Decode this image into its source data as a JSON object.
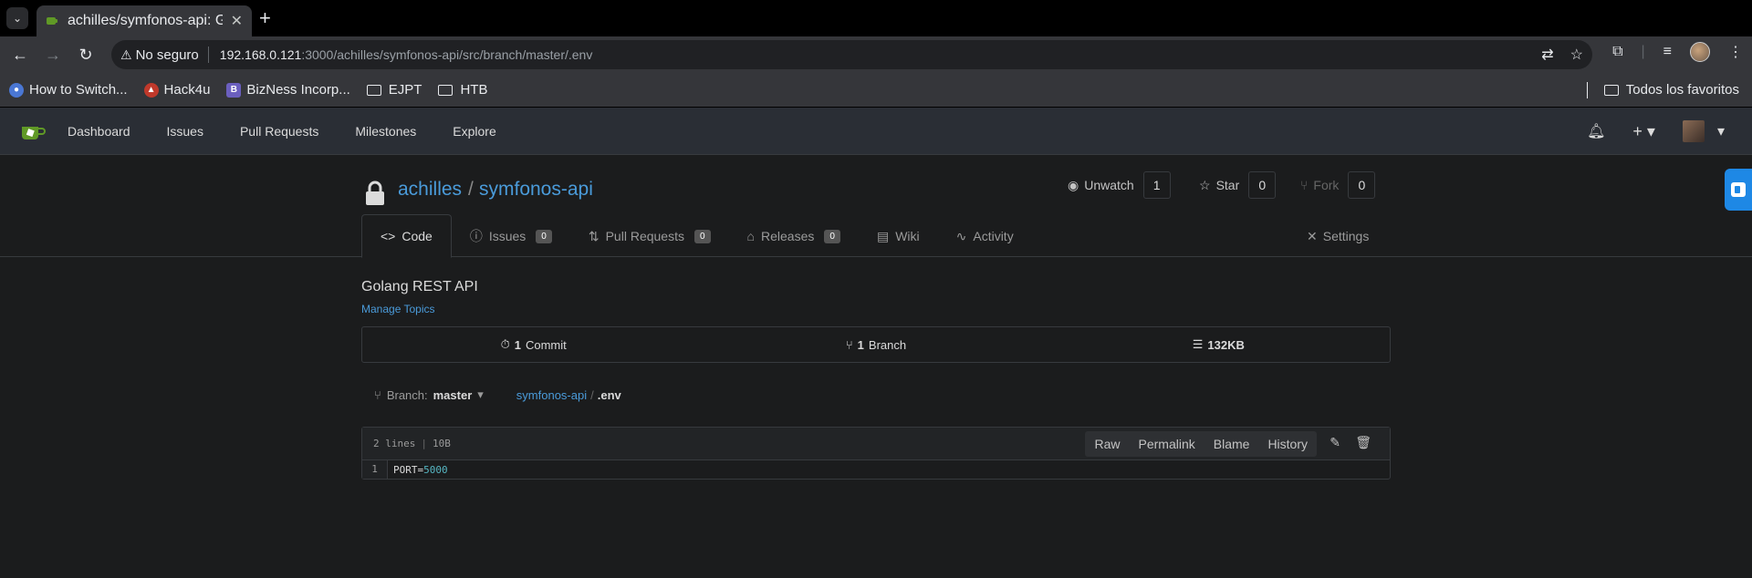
{
  "browser": {
    "tab_title": "achilles/symfonos-api: G",
    "security_label": "No seguro",
    "url_host": "192.168.0.121",
    "url_path": ":3000/achilles/symfonos-api/src/branch/master/.env",
    "bookmarks": [
      {
        "label": "How to Switch...",
        "icon": "shield-favicon",
        "color": "#4a77d4"
      },
      {
        "label": "Hack4u",
        "icon": "hack4u-favicon",
        "color": "#c0392b"
      },
      {
        "label": "BizNess Incorp...",
        "icon": "b-favicon",
        "color": "#6b5fbf"
      },
      {
        "label": "EJPT",
        "icon": "folder-icon"
      },
      {
        "label": "HTB",
        "icon": "folder-icon"
      }
    ],
    "all_bookmarks_label": "Todos los favoritos"
  },
  "gitea_nav": {
    "items": [
      "Dashboard",
      "Issues",
      "Pull Requests",
      "Milestones",
      "Explore"
    ]
  },
  "repo": {
    "owner": "achilles",
    "separator": "/",
    "name": "symfonos-api",
    "watch_label": "Unwatch",
    "watch_count": "1",
    "star_label": "Star",
    "star_count": "0",
    "fork_label": "Fork",
    "fork_count": "0",
    "tabs": {
      "code": "Code",
      "issues": "Issues",
      "issues_count": "0",
      "pulls": "Pull Requests",
      "pulls_count": "0",
      "releases": "Releases",
      "releases_count": "0",
      "wiki": "Wiki",
      "activity": "Activity",
      "settings": "Settings"
    },
    "description": "Golang REST API",
    "manage_topics": "Manage Topics",
    "stats": {
      "commits_num": "1",
      "commits_label": "Commit",
      "branches_num": "1",
      "branches_label": "Branch",
      "size": "132KB"
    },
    "branch_prefix": "Branch:",
    "branch_name": "master",
    "crumb_repo": "symfonos-api",
    "crumb_sep": "/",
    "crumb_file": ".env"
  },
  "file": {
    "lines": "2 lines",
    "size": "10B",
    "actions": [
      "Raw",
      "Permalink",
      "Blame",
      "History"
    ],
    "line_number": "1",
    "code_key": "PORT=",
    "code_value": "5000"
  },
  "colors": {
    "link": "#4a9bda",
    "background": "#1b1c1d",
    "navbar": "#2a2e35"
  }
}
